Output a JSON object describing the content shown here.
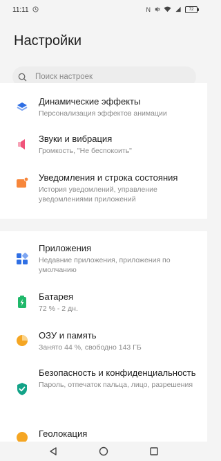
{
  "status_bar": {
    "time": "11:11",
    "network_label": "N",
    "battery": "72"
  },
  "page": {
    "title": "Настройки"
  },
  "search": {
    "placeholder": "Поиск настроек"
  },
  "section1": {
    "items": [
      {
        "title": "Динамические эффекты",
        "subtitle": "Персонализация эффектов анимации",
        "icon": "layers-icon"
      },
      {
        "title": "Звуки и вибрация",
        "subtitle": "Громкость, \"Не беспокоить\"",
        "icon": "speaker-icon"
      },
      {
        "title": "Уведомления и строка состояния",
        "subtitle": "История уведомлений, управление уведомлениями приложений",
        "icon": "notification-icon"
      }
    ]
  },
  "section2": {
    "items": [
      {
        "title": "Приложения",
        "subtitle": "Недавние приложения, приложения по умолчанию",
        "icon": "apps-icon"
      },
      {
        "title": "Батарея",
        "subtitle": "72 % - 2 дн.",
        "icon": "battery-icon"
      },
      {
        "title": "ОЗУ и память",
        "subtitle": "Занято 44 %, свободно 143 ГБ",
        "icon": "storage-icon"
      },
      {
        "title": "Безопасность и конфиденциальность",
        "subtitle": "Пароль, отпечаток пальца, лицо, разрешения",
        "icon": "shield-icon"
      },
      {
        "title": "Геолокация",
        "subtitle": "",
        "icon": "location-icon"
      }
    ]
  },
  "colors": {
    "blue": "#2f6fe4",
    "pink": "#f0537a",
    "orange": "#f7863a",
    "green": "#1fb86a",
    "amber": "#f5a623",
    "teal": "#13a388"
  }
}
